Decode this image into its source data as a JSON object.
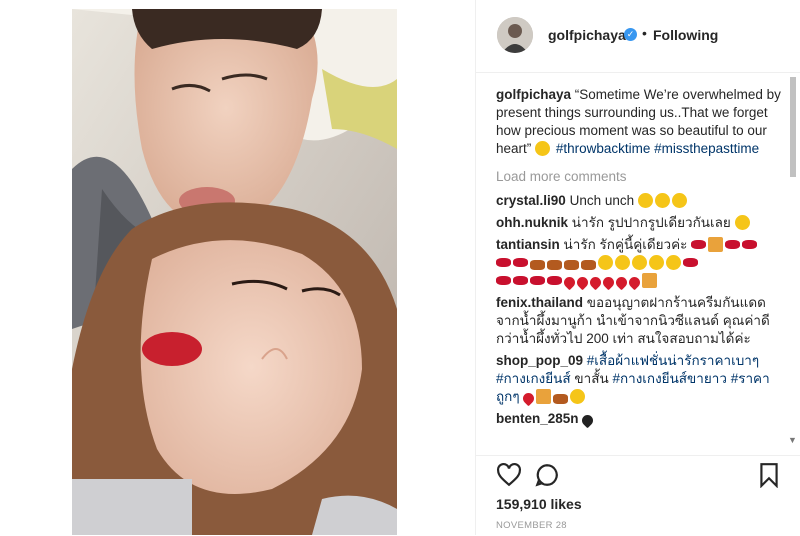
{
  "post": {
    "username": "golfpichaya",
    "follow_label": "Following",
    "dot": "•",
    "verified_glyph": "✓"
  },
  "caption": {
    "username": "golfpichaya",
    "text": "“Sometime We’re overwhelmed by present things surrounding us..That we forget how precious moment was so beautiful to our heart”",
    "hashtag1": "#throwbacktime",
    "hashtag2": "#missthepasttime"
  },
  "load_more": "Load more comments",
  "comments": [
    {
      "user": "crystal.li90",
      "text": "Unch unch"
    },
    {
      "user": "ohh.nuknik",
      "text": "น่ารัก รูปปากรูปเดียวกันเลย"
    },
    {
      "user": "tantiansin",
      "text": "น่ารัก รักคู่นี้คู่เดียวค่ะ"
    },
    {
      "user": "fenix.thailand",
      "text": "ขออนุญาตฝากร้านครีมกันแดด จากน้ำผึ้งมานูก้า นำเข้าจากนิวซีแลนด์ คุณค่าดีกว่าน้ำผึ้งทั่วไป 200 เท่า สนใจสอบถามได้ค่ะ"
    },
    {
      "user": "shop_pop_09",
      "tag1": "#เสื้อผ้าแฟชั่นน่ารักราคาเบาๆ",
      "tag2": "#กางเกงยีนส์",
      "mid": "ขาสั้น",
      "tag3": "#กางเกงยีนส์ขายาว",
      "tag4": "#ราคาถูกๆ"
    },
    {
      "user": "benten_285n",
      "text": ""
    }
  ],
  "likes": "159,910 likes",
  "date": "NOVEMBER 28",
  "icons": {
    "like": "heart-outline",
    "comment": "speech-bubble",
    "save": "bookmark",
    "verified": "verified-badge"
  },
  "colors": {
    "hashtag": "#003569",
    "verified": "#3897f0",
    "muted": "#999999"
  }
}
